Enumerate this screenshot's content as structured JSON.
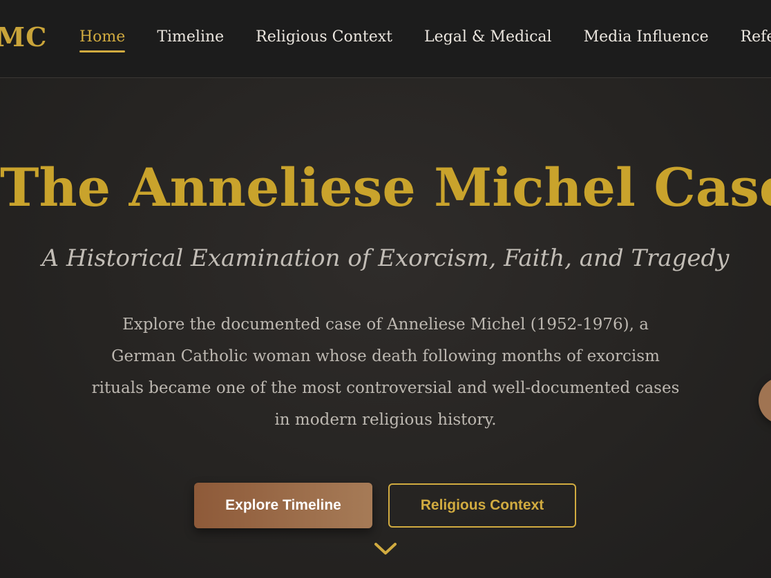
{
  "header": {
    "logo": "MC",
    "nav": [
      {
        "label": "Home",
        "active": true
      },
      {
        "label": "Timeline",
        "active": false
      },
      {
        "label": "Religious Context",
        "active": false
      },
      {
        "label": "Legal & Medical",
        "active": false
      },
      {
        "label": "Media Influence",
        "active": false
      },
      {
        "label": "Refere",
        "active": false
      }
    ]
  },
  "hero": {
    "title": "The Anneliese Michel Case",
    "subtitle": "A Historical Examination of Exorcism, Faith, and Tragedy",
    "description": "Explore the documented case of Anneliese Michel (1952-1976), a German Catholic woman whose death following months of exorcism rituals became one of the most controversial and well-documented cases in modern religious history.",
    "primary_button": "Explore Timeline",
    "secondary_button": "Religious Context",
    "scroll_icon": "chevron-down-icon"
  },
  "colors": {
    "accent_gold": "#d1ab40",
    "title_gold": "#c9a32c",
    "button_brown": "#9a6c4a",
    "background": "#262422",
    "navbar": "#1c1c1c"
  }
}
